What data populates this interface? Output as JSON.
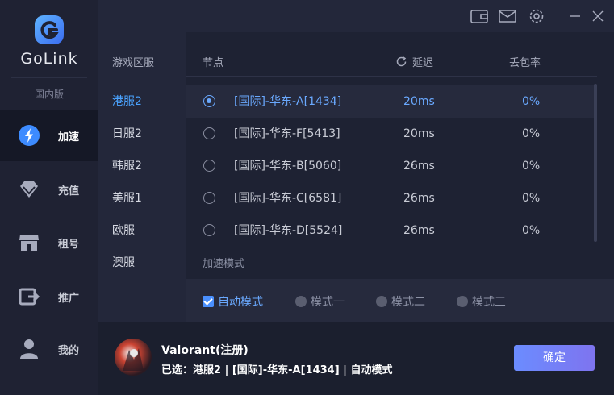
{
  "app": {
    "name": "GoLink",
    "region_tag": "国内版"
  },
  "nav": [
    {
      "label": "加速",
      "icon": "lightning-icon",
      "active": true
    },
    {
      "label": "充值",
      "icon": "diamond-icon",
      "active": false
    },
    {
      "label": "租号",
      "icon": "store-icon",
      "active": false
    },
    {
      "label": "推广",
      "icon": "share-icon",
      "active": false
    },
    {
      "label": "我的",
      "icon": "user-icon",
      "active": false
    }
  ],
  "topbar": {
    "icons": [
      "wallet-icon",
      "mail-icon",
      "settings-icon",
      "minimize-icon",
      "close-icon"
    ]
  },
  "regions": {
    "header": "游戏区服",
    "items": [
      "港服2",
      "日服2",
      "韩服2",
      "美服1",
      "欧服",
      "澳服"
    ],
    "selected": "港服2"
  },
  "nodes": {
    "header_node": "节点",
    "header_latency": "延迟",
    "header_loss": "丢包率",
    "rows": [
      {
        "name": "[国际]-华东-A[1434]",
        "latency": "20ms",
        "loss": "0%",
        "selected": true
      },
      {
        "name": "[国际]-华东-F[5413]",
        "latency": "20ms",
        "loss": "0%",
        "selected": false
      },
      {
        "name": "[国际]-华东-B[5060]",
        "latency": "26ms",
        "loss": "0%",
        "selected": false
      },
      {
        "name": "[国际]-华东-C[6581]",
        "latency": "26ms",
        "loss": "0%",
        "selected": false
      },
      {
        "name": "[国际]-华东-D[5524]",
        "latency": "26ms",
        "loss": "0%",
        "selected": false
      }
    ]
  },
  "modes": {
    "title": "加速模式",
    "options": [
      "自动模式",
      "模式一",
      "模式二",
      "模式三"
    ],
    "selected": "自动模式"
  },
  "footer": {
    "game_title": "Valorant(注册)",
    "selected_info": "已选：港服2 | [国际]-华东-A[1434] | 自动模式",
    "confirm_label": "确定"
  },
  "colors": {
    "accent": "#6aa9ff",
    "button_start": "#6b8cff",
    "button_end": "#7e74ef",
    "sidebar": "#1f2233",
    "panel": "#23273a"
  }
}
